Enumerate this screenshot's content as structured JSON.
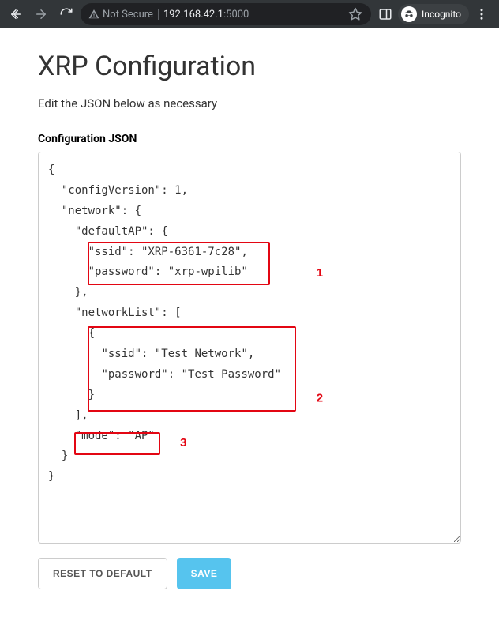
{
  "browser": {
    "not_secure_label": "Not Secure",
    "url_host": "192.168.42.1",
    "url_port": ":5000",
    "incognito_label": "Incognito"
  },
  "page": {
    "title": "XRP Configuration",
    "subtitle": "Edit the JSON below as necessary",
    "config_label": "Configuration JSON",
    "json_text": "{\n  \"configVersion\": 1,\n  \"network\": {\n    \"defaultAP\": {\n      \"ssid\": \"XRP-6361-7c28\",\n      \"password\": \"xrp-wpilib\"\n    },\n    \"networkList\": [\n      {\n        \"ssid\": \"Test Network\",\n        \"password\": \"Test Password\"\n      }\n    ],\n    \"mode\": \"AP\"\n  }\n}\n\n\n\n",
    "reset_label": "Reset to Default",
    "save_label": "Save"
  },
  "annotations": {
    "one": "1",
    "two": "2",
    "three": "3"
  }
}
